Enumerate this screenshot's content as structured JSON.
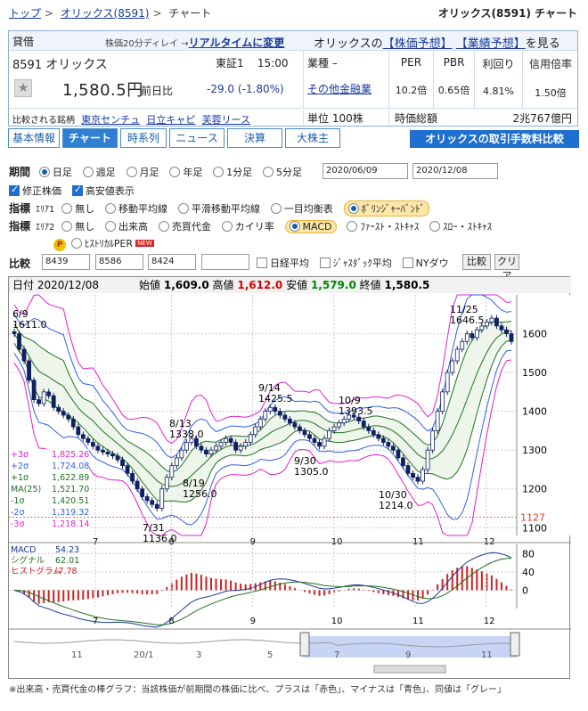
{
  "breadcrumb": {
    "top": "トップ",
    "company": "オリックス(8591)",
    "current": "チャート"
  },
  "page_title": "オリックス(8591) チャート",
  "stock": {
    "kashi": "貸借",
    "realtime_note": "株価20分ディレイ →",
    "realtime_link": "リアルタイムに変更",
    "name_prefix": "オリックスの",
    "forecast_link": "【株価予想】",
    "earnings_link": "【業績予想】",
    "name_suffix": "を見る",
    "code": "8591",
    "name": "オリックス",
    "exchange": "東証1",
    "time": "15:00",
    "price": "1,580.5円",
    "prev_label": "前日比",
    "change": "-29.0",
    "change_pct": "(-1.80%)",
    "industry_label": "業種",
    "industry_dash": "–",
    "industry": "その他金融業",
    "metrics": [
      {
        "h": "PER",
        "v": "10.2倍"
      },
      {
        "h": "PBR",
        "v": "0.65倍"
      },
      {
        "h": "利回り",
        "v": "4.81%"
      },
      {
        "h": "信用倍率",
        "v": "1.50倍"
      }
    ],
    "compare_label": "比較される銘柄",
    "compare": [
      "東京センチュ",
      "日立キャピ",
      "芙蓉リース"
    ],
    "unit": "単位 100株",
    "mcap_label": "時価総額",
    "mcap": "2兆767億円"
  },
  "tabs": [
    "基本情報",
    "チャート",
    "時系列",
    "ニュース",
    "決算",
    "大株主"
  ],
  "fee_button": "オリックスの取引手数料比較",
  "controls": {
    "period_label": "期間",
    "periods": [
      "日足",
      "週足",
      "月足",
      "年足",
      "1分足",
      "5分足"
    ],
    "date_from": "2020/06/09",
    "date_to": "2020/12/08",
    "adj": "修正株価",
    "hl": "高安値表示",
    "ind_label": "指標",
    "area1": "ｴﾘｱ1",
    "area1_opts": [
      "無し",
      "移動平均線",
      "平滑移動平均線",
      "一目均衡表",
      "ﾎﾞﾘﾝｼﾞｬｰﾊﾞﾝﾄﾞ"
    ],
    "area2": "ｴﾘｱ2",
    "area2_opts": [
      "無し",
      "出来高",
      "売買代金",
      "カイリ率",
      "MACD",
      "ﾌｧｰｽﾄ・ｽﾄｷｬｽ",
      "ｽﾛｰ・ｽﾄｷｬｽ"
    ],
    "per_opt": "ﾋｽﾄﾘｶﾙPER",
    "new_badge": "NEW",
    "cmp_label": "比較",
    "cmp_codes": [
      "8439",
      "8586",
      "8424",
      ""
    ],
    "cmp_opts": [
      "日経平均",
      "ｼﾞｬｽﾀﾞｯｸ平均",
      "NYダウ"
    ],
    "cmp_btn": "比較",
    "clear_btn": "クリア"
  },
  "chart_data": {
    "type": "candlestick",
    "header": {
      "date_label": "日付",
      "date": "2020/12/08",
      "open_label": "始値",
      "open": "1,609.0",
      "high_label": "高値",
      "high": "1,612.0",
      "low_label": "安値",
      "low": "1,579.0",
      "close_label": "終値",
      "close": "1,580.5"
    },
    "y_ticks": [
      1100,
      1200,
      1300,
      1400,
      1500,
      1600
    ],
    "ylim": [
      1080,
      1700
    ],
    "x_ticks": [
      "7",
      "8",
      "9",
      "10",
      "11",
      "12"
    ],
    "current_price_label": "1127",
    "bands": [
      {
        "name": "+3σ",
        "value": "1,825.26"
      },
      {
        "name": "+2σ",
        "value": "1,724.08"
      },
      {
        "name": "+1σ",
        "value": "1,622.89"
      },
      {
        "name": "MA(25)",
        "value": "1,521.70"
      },
      {
        "name": "-1σ",
        "value": "1,420.51"
      },
      {
        "name": "-2σ",
        "value": "1,319.32"
      },
      {
        "name": "-3σ",
        "value": "1,218.14"
      }
    ],
    "annotations": [
      {
        "d": "6/9",
        "v": "1611.0"
      },
      {
        "d": "7/31",
        "v": "1136.0"
      },
      {
        "d": "8/13",
        "v": "1338.0"
      },
      {
        "d": "8/19",
        "v": "1256.0"
      },
      {
        "d": "9/14",
        "v": "1425.5"
      },
      {
        "d": "9/30",
        "v": "1305.0"
      },
      {
        "d": "10/9",
        "v": "1393.5"
      },
      {
        "d": "10/30",
        "v": "1214.0"
      },
      {
        "d": "11/25",
        "v": "1646.5"
      }
    ],
    "close": [
      1600,
      1560,
      1530,
      1480,
      1430,
      1420,
      1450,
      1440,
      1410,
      1400,
      1390,
      1380,
      1360,
      1340,
      1330,
      1320,
      1310,
      1300,
      1295,
      1290,
      1285,
      1275,
      1260,
      1240,
      1220,
      1200,
      1180,
      1170,
      1160,
      1150,
      1200,
      1230,
      1260,
      1280,
      1300,
      1320,
      1330,
      1310,
      1300,
      1290,
      1300,
      1310,
      1320,
      1330,
      1320,
      1300,
      1310,
      1320,
      1340,
      1360,
      1380,
      1400,
      1410,
      1400,
      1390,
      1380,
      1370,
      1360,
      1350,
      1340,
      1330,
      1320,
      1310,
      1330,
      1350,
      1360,
      1370,
      1380,
      1390,
      1385,
      1375,
      1360,
      1350,
      1340,
      1330,
      1320,
      1310,
      1300,
      1280,
      1260,
      1240,
      1230,
      1220,
      1250,
      1300,
      1350,
      1400,
      1450,
      1500,
      1530,
      1560,
      1580,
      1600,
      1590,
      1610,
      1620,
      1630,
      1640,
      1620,
      1610,
      1600,
      1580
    ],
    "macd": {
      "labels": [
        "MACD",
        "シグナル",
        "ヒストグラム"
      ],
      "values": [
        "54.23",
        "62.01",
        "-7.78"
      ],
      "y_ticks": [
        0,
        40,
        80
      ]
    },
    "navigator_ticks": [
      "11",
      "20/1",
      "3",
      "5",
      "7",
      "9",
      "11"
    ]
  },
  "footnote": "※出来高・売買代金の棒グラフ：当該株価が前期間の株価に比べ、プラスは「赤色」、マイナスは「青色」、同値は「グレー」"
}
